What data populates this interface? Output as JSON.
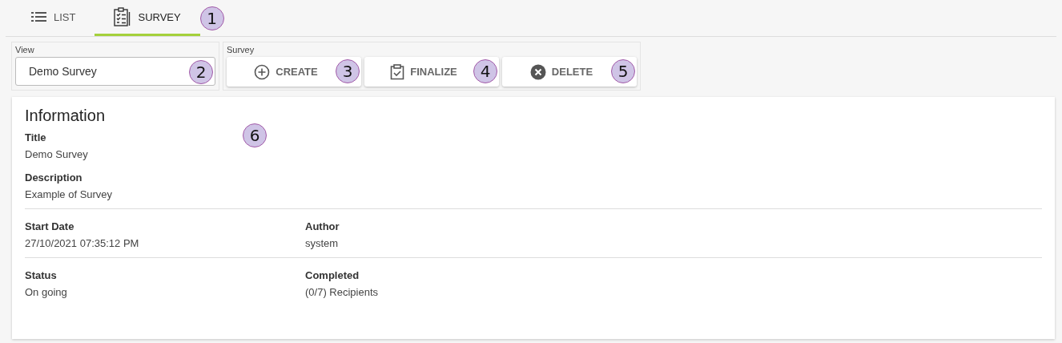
{
  "tabs": [
    {
      "label": "LIST",
      "selected": false
    },
    {
      "label": "SURVEY",
      "selected": true,
      "callout": "1"
    }
  ],
  "view": {
    "label": "View",
    "value": "Demo Survey",
    "callout": "2"
  },
  "survey": {
    "label": "Survey",
    "buttons": [
      {
        "label": "CREATE",
        "callout": "3"
      },
      {
        "label": "FINALIZE",
        "callout": "4"
      },
      {
        "label": "DELETE",
        "callout": "5"
      }
    ]
  },
  "information": {
    "title": "Information",
    "callout": "6",
    "sections": [
      {
        "fields": [
          {
            "label": "Title",
            "value": "Demo Survey"
          }
        ]
      },
      {
        "fields": [
          {
            "label": "Description",
            "value": "Example of Survey"
          }
        ]
      },
      {
        "fields": [
          {
            "label": "Start Date",
            "value": "27/10/2021 07:35:12 PM"
          },
          {
            "label": "Author",
            "value": "system"
          }
        ],
        "divider": true
      },
      {
        "fields": [
          {
            "label": "Status",
            "value": "On going"
          },
          {
            "label": "Completed",
            "value": "(0/7) Recipients"
          }
        ],
        "divider": true
      }
    ]
  }
}
